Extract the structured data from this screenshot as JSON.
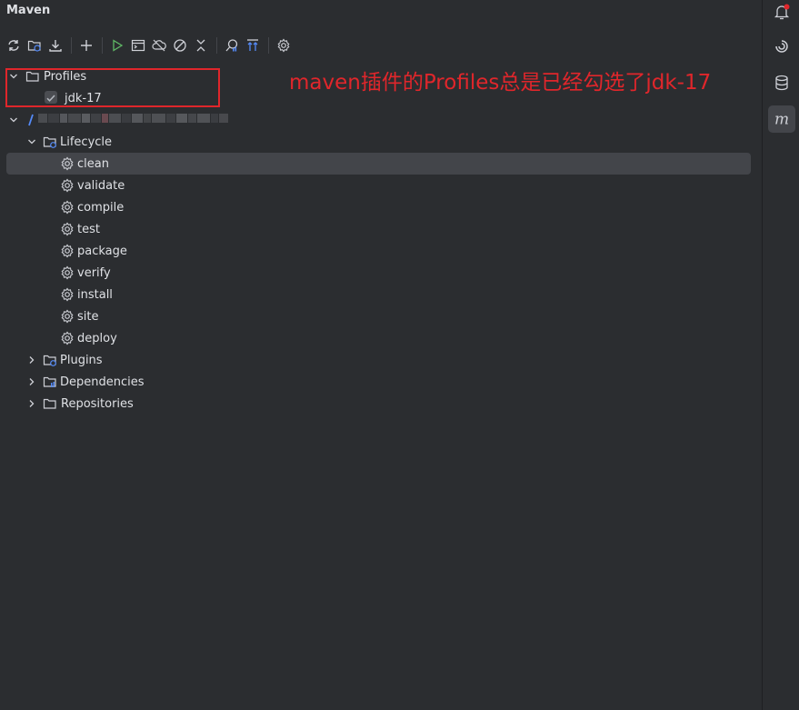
{
  "window": {
    "title": "Maven"
  },
  "annotation": "maven插件的Profiles总是已经勾选了jdk-17",
  "tree": {
    "profiles": {
      "label": "Profiles",
      "items": [
        {
          "label": "jdk-17",
          "checked": true
        }
      ]
    },
    "lifecycle": {
      "label": "Lifecycle",
      "phases": [
        "clean",
        "validate",
        "compile",
        "test",
        "package",
        "verify",
        "install",
        "site",
        "deploy"
      ]
    },
    "plugins": {
      "label": "Plugins"
    },
    "dependencies": {
      "label": "Dependencies"
    },
    "repositories": {
      "label": "Repositories"
    }
  },
  "toolbar": [
    "reload-icon",
    "add-project-icon",
    "download-icon",
    "plus-icon",
    "run-icon",
    "terminal-icon",
    "offline-icon",
    "skip-tests-icon",
    "collapse-icon",
    "analyze-icon",
    "show-deps-icon",
    "settings-icon"
  ],
  "colors": {
    "accent_red": "#e0262b",
    "selected_row": "#43454a",
    "background": "#2b2d30",
    "run_green": "#5fb865",
    "icon_blue": "#548af7"
  }
}
